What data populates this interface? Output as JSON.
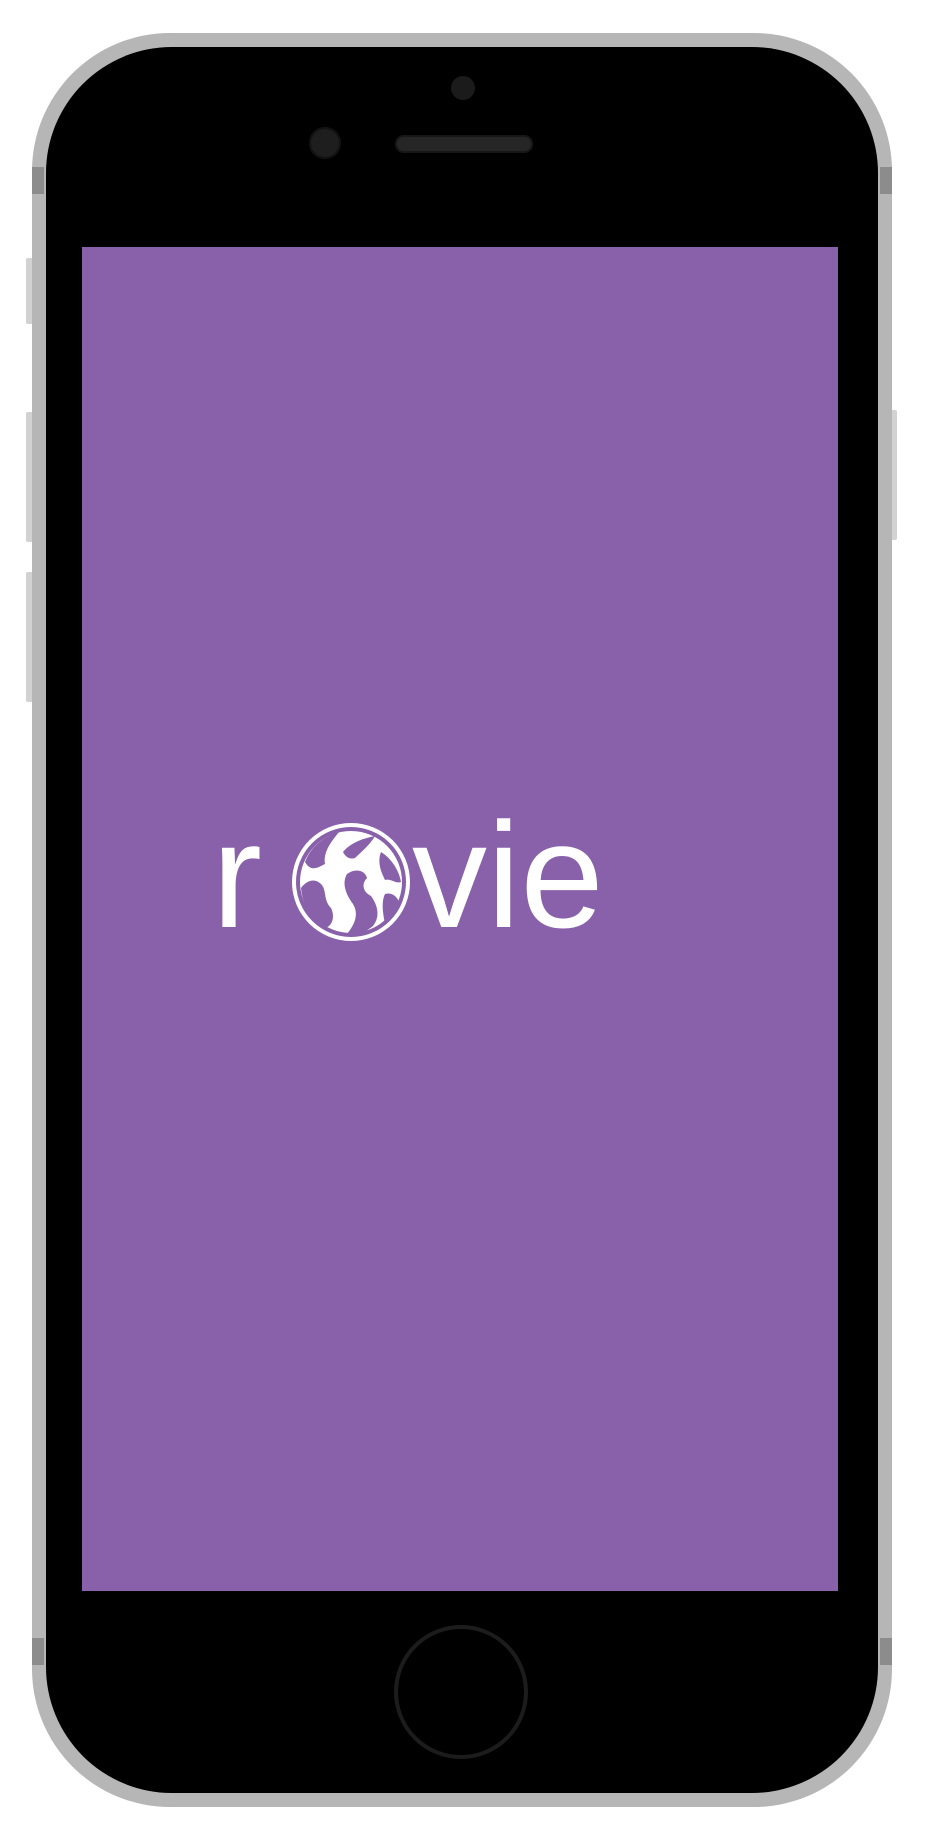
{
  "device": {
    "frame_color": "#b6b6b6",
    "bezel_color": "#000000"
  },
  "splash": {
    "background_color": "#8961aa",
    "logo": {
      "text": "rovie",
      "icon": "globe-icon",
      "color": "#ffffff"
    }
  }
}
